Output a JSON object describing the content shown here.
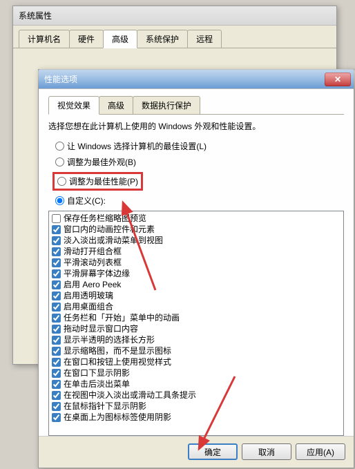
{
  "sysprop": {
    "title": "系统属性",
    "tabs": [
      "计算机名",
      "硬件",
      "高级",
      "系统保护",
      "远程"
    ],
    "active_tab": 2
  },
  "perf": {
    "title": "性能选项",
    "tabs": [
      "视觉效果",
      "高级",
      "数据执行保护"
    ],
    "active_tab": 0,
    "desc": "选择您想在此计算机上使用的 Windows 外观和性能设置。",
    "radios": {
      "let_windows": "让 Windows 选择计算机的最佳设置(L)",
      "best_appearance": "调整为最佳外观(B)",
      "best_performance": "调整为最佳性能(P)",
      "custom": "自定义(C):"
    },
    "selected_radio": 3,
    "checks": [
      {
        "c": false,
        "t": "保存任务栏缩略图预览"
      },
      {
        "c": true,
        "t": "窗口内的动画控件和元素"
      },
      {
        "c": true,
        "t": "淡入淡出或滑动菜单到视图"
      },
      {
        "c": true,
        "t": "滑动打开组合框"
      },
      {
        "c": true,
        "t": "平滑滚动列表框"
      },
      {
        "c": true,
        "t": "平滑屏幕字体边缘"
      },
      {
        "c": true,
        "t": "启用 Aero Peek"
      },
      {
        "c": true,
        "t": "启用透明玻璃"
      },
      {
        "c": true,
        "t": "启用桌面组合"
      },
      {
        "c": true,
        "t": "任务栏和「开始」菜单中的动画"
      },
      {
        "c": true,
        "t": "拖动时显示窗口内容"
      },
      {
        "c": true,
        "t": "显示半透明的选择长方形"
      },
      {
        "c": true,
        "t": "显示缩略图，而不是显示图标"
      },
      {
        "c": true,
        "t": "在窗口和按钮上使用视觉样式"
      },
      {
        "c": true,
        "t": "在窗口下显示阴影"
      },
      {
        "c": true,
        "t": "在单击后淡出菜单"
      },
      {
        "c": true,
        "t": "在视图中淡入淡出或滑动工具条提示"
      },
      {
        "c": true,
        "t": "在鼠标指针下显示阴影"
      },
      {
        "c": true,
        "t": "在桌面上为图标标签使用阴影"
      }
    ],
    "buttons": {
      "ok": "确定",
      "cancel": "取消",
      "apply": "应用(A)"
    }
  }
}
